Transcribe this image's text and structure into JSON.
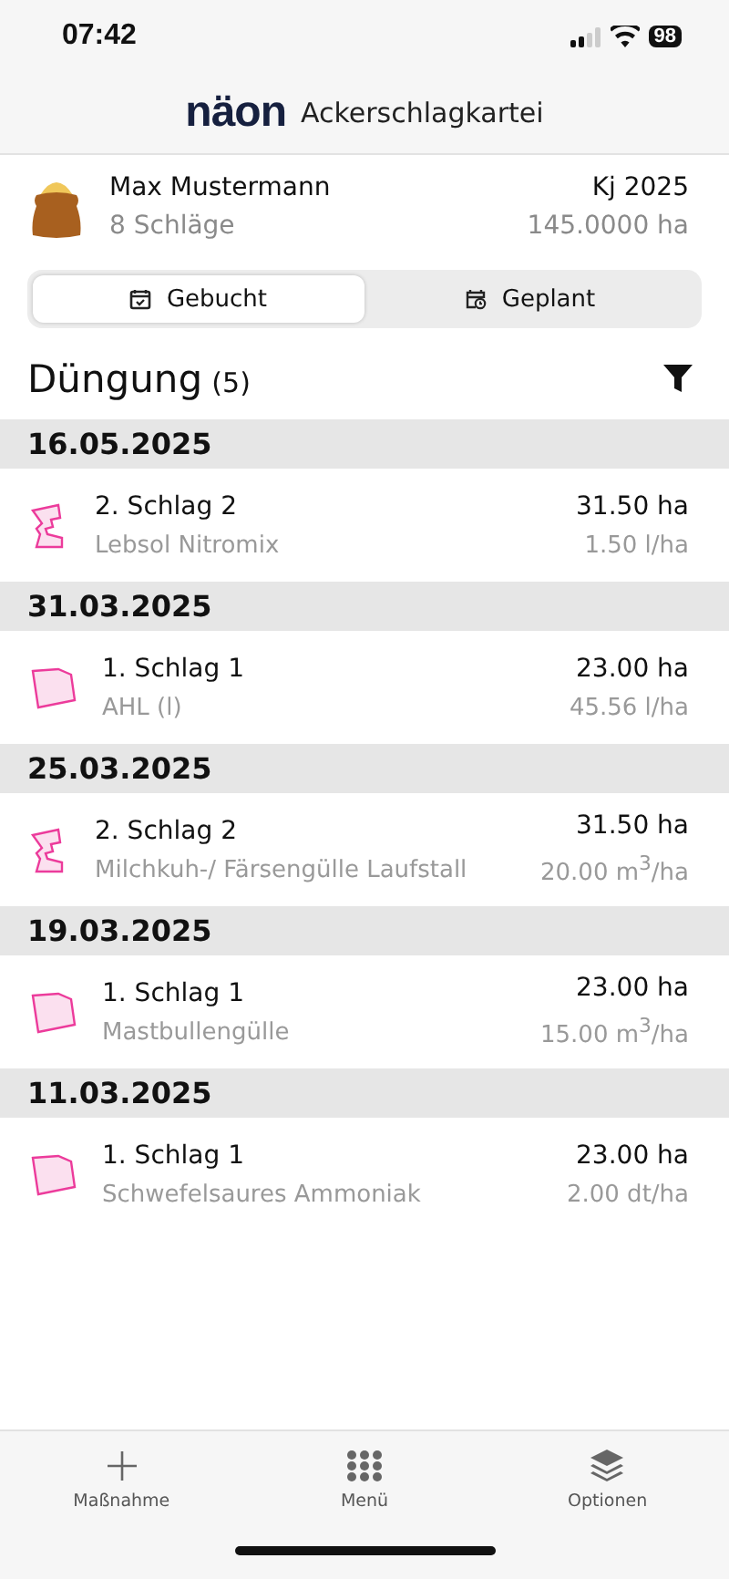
{
  "status_bar": {
    "time": "07:42",
    "battery": "98"
  },
  "header": {
    "logo": "näon",
    "title": "Ackerschlagkartei"
  },
  "farm": {
    "name": "Max Mustermann",
    "fields": "8 Schläge",
    "year": "Kj 2025",
    "area": "145.0000 ha"
  },
  "tabs": [
    {
      "label": "Gebucht",
      "kind": "calendar-check",
      "selected": true
    },
    {
      "label": "Geplant",
      "kind": "calendar-clock",
      "selected": false
    }
  ],
  "section": {
    "title": "Düngung",
    "count": "(5)"
  },
  "groups": [
    {
      "date": "16.05.2025",
      "entries": [
        {
          "kind": "notched",
          "field": "2. Schlag 2",
          "area": "31.50 ha",
          "product": "Lebsol Nitromix",
          "rate": "1.50 l/ha"
        }
      ]
    },
    {
      "date": "31.03.2025",
      "entries": [
        {
          "kind": "quad",
          "field": "1. Schlag 1",
          "area": "23.00 ha",
          "product": "AHL (l)",
          "rate": "45.56 l/ha"
        }
      ]
    },
    {
      "date": "25.03.2025",
      "entries": [
        {
          "kind": "notched",
          "field": "2. Schlag 2",
          "area": "31.50 ha",
          "product": "Milchkuh-/ Färsengülle Laufstall",
          "rate": "20.00 m$^{3}$/ha"
        }
      ]
    },
    {
      "date": "19.03.2025",
      "entries": [
        {
          "kind": "quad",
          "field": "1. Schlag 1",
          "area": "23.00 ha",
          "product": "Mastbullengülle",
          "rate": "15.00 m$^{3}$/ha"
        }
      ]
    },
    {
      "date": "11.03.2025",
      "entries": [
        {
          "kind": "quad",
          "field": "1. Schlag 1",
          "area": "23.00 ha",
          "product": "Schwefelsaures Ammoniak",
          "rate": "2.00 dt/ha"
        }
      ]
    }
  ],
  "bottom_nav": [
    {
      "label": "Maßnahme",
      "kind": "plus"
    },
    {
      "label": "Menü",
      "kind": "grid"
    },
    {
      "label": "Optionen",
      "kind": "layers"
    }
  ]
}
